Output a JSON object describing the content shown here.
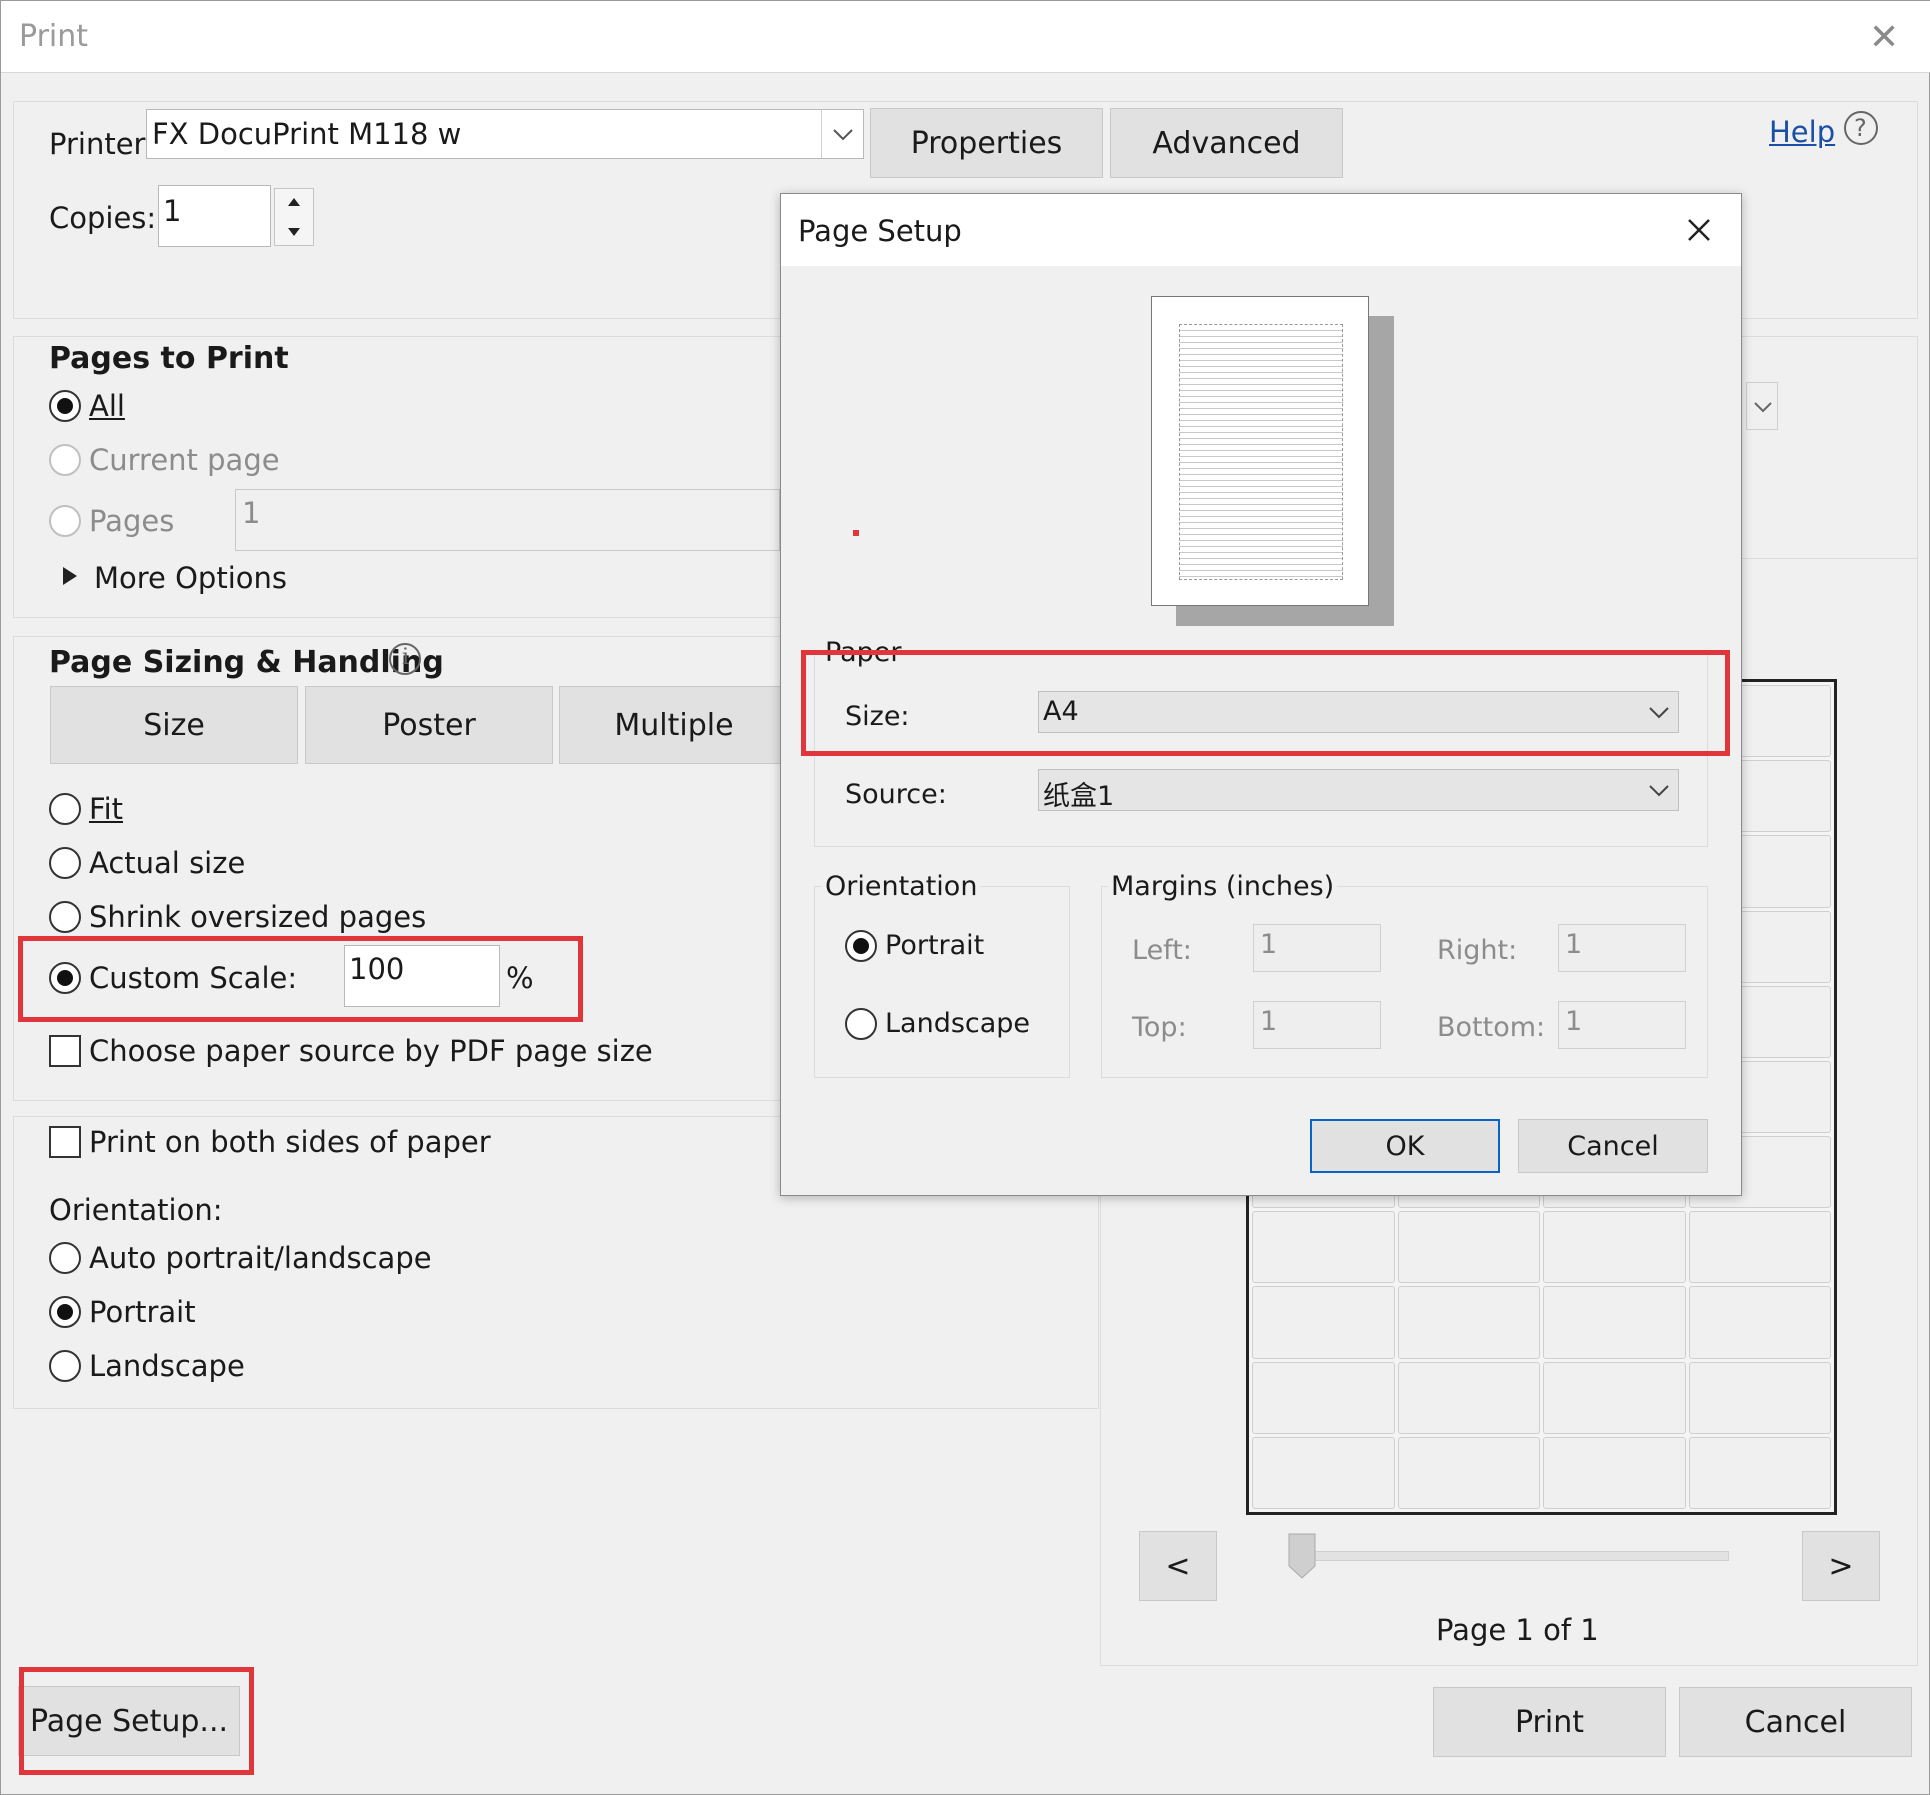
{
  "window": {
    "title": "Print",
    "close_glyph": "✕"
  },
  "printer": {
    "label": "Printer:",
    "selected": "FX DocuPrint M118 w",
    "properties": "Properties",
    "advanced": "Advanced",
    "help": "Help"
  },
  "copies": {
    "label": "Copies:",
    "value": "1"
  },
  "pages_to_print": {
    "title": "Pages to Print",
    "all": "All",
    "current": "Current page",
    "pages": "Pages",
    "pages_value": "1",
    "more_options": "More Options"
  },
  "sizing": {
    "title": "Page Sizing & Handling",
    "tabs": [
      "Size",
      "Poster",
      "Multiple"
    ],
    "fit": "Fit",
    "actual": "Actual size",
    "shrink": "Shrink oversized pages",
    "custom": "Custom Scale:",
    "custom_value": "100",
    "percent": "%",
    "choose_paper": "Choose paper source by PDF page size"
  },
  "duplex": {
    "label": "Print on both sides of paper"
  },
  "orientation": {
    "title": "Orientation:",
    "auto": "Auto portrait/landscape",
    "portrait": "Portrait",
    "landscape": "Landscape"
  },
  "preview": {
    "prev": "<",
    "next": ">",
    "page_label": "Page 1 of 1"
  },
  "bottom": {
    "page_setup": "Page Setup...",
    "print": "Print",
    "cancel": "Cancel"
  },
  "page_setup_dialog": {
    "title": "Page Setup",
    "paper_group": "Paper",
    "size_label": "Size:",
    "size_value": "A4",
    "source_label": "Source:",
    "source_value": "纸盒1",
    "orientation_group": "Orientation",
    "portrait": "Portrait",
    "landscape": "Landscape",
    "margins_group": "Margins (inches)",
    "left_label": "Left:",
    "left_value": "1",
    "right_label": "Right:",
    "right_value": "1",
    "top_label": "Top:",
    "top_value": "1",
    "bottom_label": "Bottom:",
    "bottom_value": "1",
    "ok": "OK",
    "cancel": "Cancel"
  },
  "highlight_color": "#e0363b"
}
